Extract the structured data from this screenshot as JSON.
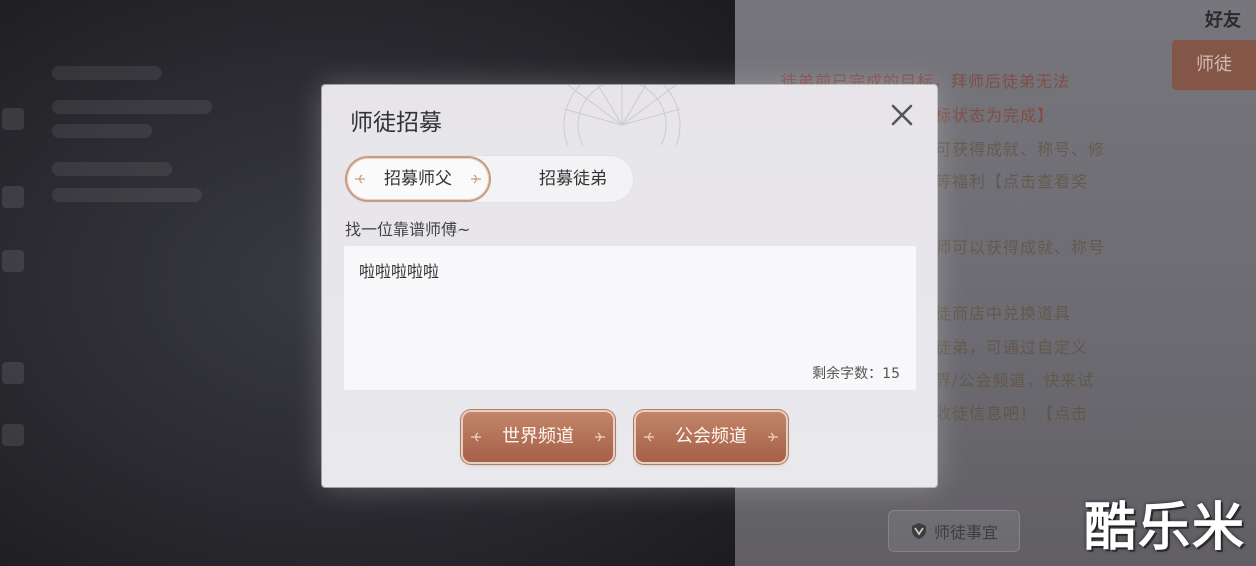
{
  "dialog": {
    "title": "师徒招募",
    "tabs": [
      {
        "label": "招募师父",
        "active": true
      },
      {
        "label": "招募徒弟",
        "active": false
      }
    ],
    "subtitle": "找一位靠谱师傅~",
    "message": {
      "value": "啦啦啦啦啦",
      "remaining_label": "剩余字数：15"
    },
    "buttons": {
      "world_channel": "世界频道",
      "guild_channel": "公会频道"
    }
  },
  "background": {
    "friend_label": "好友",
    "master_tab_label": "师徒",
    "panel_lines": [
      "徒弟前已完成的目标，拜师后徒弟无法",
      "标状态为完成】",
      "可获得成就、称号、修",
      "等福利【点击查看奖",
      "师可以获得成就、称号",
      "徒商店中兑换道具",
      "徒弟，可通过自定义",
      "界/公会频道，快来试",
      "收徒信息吧！【点击"
    ],
    "matters_button": "师徒事宜"
  },
  "watermark": "酷乐米",
  "colors": {
    "accent_button": "#b06c52",
    "dialog_bg": "#e8e7eb",
    "active_tab_border": "#c79a82"
  }
}
